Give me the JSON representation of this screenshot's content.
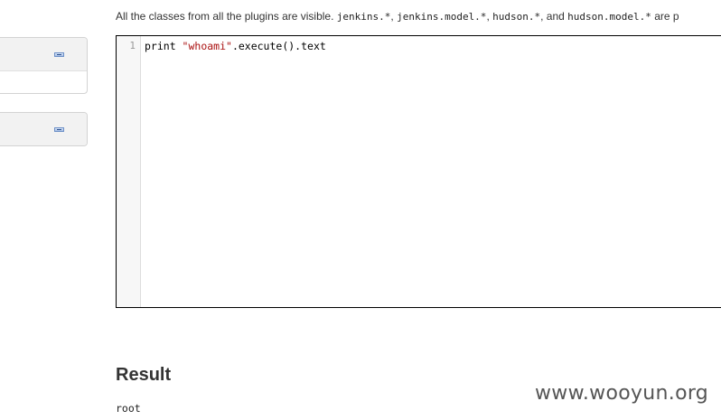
{
  "description": {
    "text_before": "All the classes from all the plugins are visible.",
    "code1": "jenkins.*",
    "sep1": ",",
    "code2": "jenkins.model.*",
    "sep2": ",",
    "code3": "hudson.*",
    "sep3": ", and",
    "code4": "hudson.model.*",
    "text_after": "are p"
  },
  "editor": {
    "line_number": "1",
    "code_prefix": "print ",
    "code_string": "\"whoami\"",
    "code_suffix": ".execute().text"
  },
  "result": {
    "heading": "Result",
    "output": "root"
  },
  "watermark": "www.wooyun.org"
}
